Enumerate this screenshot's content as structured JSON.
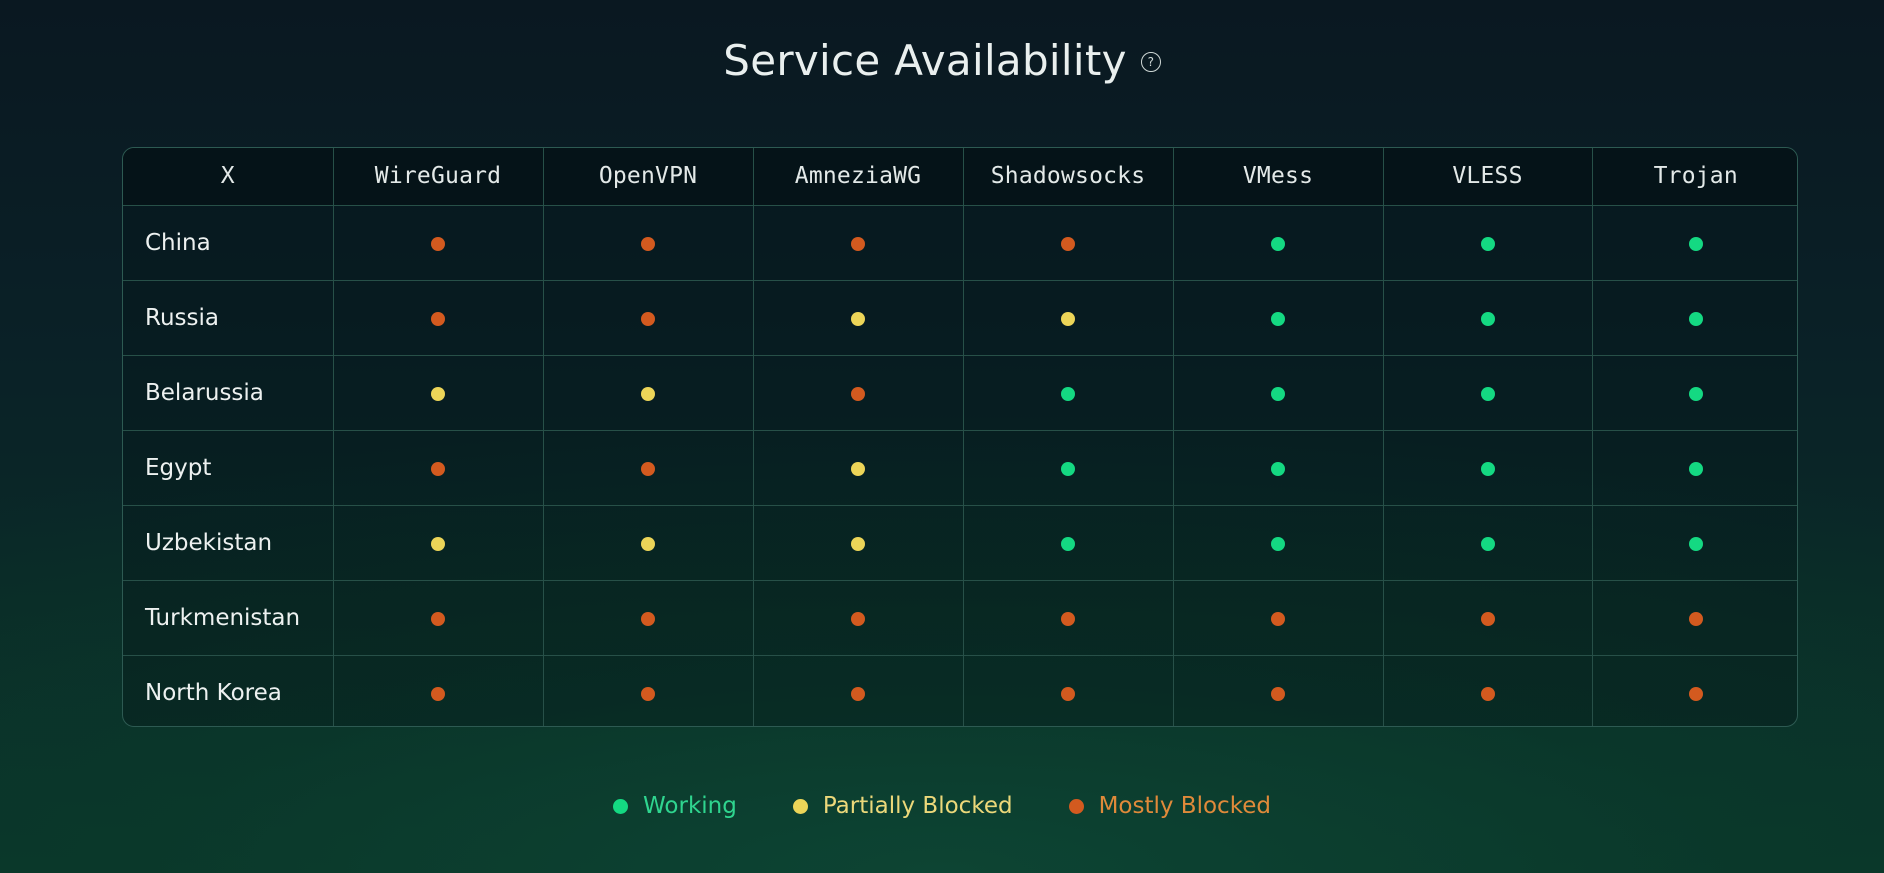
{
  "title": "Service Availability",
  "help_icon": "question-circle-icon",
  "colors": {
    "working": "#14d982",
    "partial": "#ecd558",
    "blocked": "#d35a1f",
    "legend_working_text": "#2fd58f",
    "legend_partial_text": "#ecd87a",
    "legend_blocked_text": "#e08a3a"
  },
  "table": {
    "corner": "X",
    "protocols": [
      "WireGuard",
      "OpenVPN",
      "AmneziaWG",
      "Shadowsocks",
      "VMess",
      "VLESS",
      "Trojan"
    ],
    "rows": [
      {
        "country": "China",
        "status": [
          "blocked",
          "blocked",
          "blocked",
          "blocked",
          "working",
          "working",
          "working"
        ]
      },
      {
        "country": "Russia",
        "status": [
          "blocked",
          "blocked",
          "partial",
          "partial",
          "working",
          "working",
          "working"
        ]
      },
      {
        "country": "Belarussia",
        "status": [
          "partial",
          "partial",
          "blocked",
          "working",
          "working",
          "working",
          "working"
        ]
      },
      {
        "country": "Egypt",
        "status": [
          "blocked",
          "blocked",
          "partial",
          "working",
          "working",
          "working",
          "working"
        ]
      },
      {
        "country": "Uzbekistan",
        "status": [
          "partial",
          "partial",
          "partial",
          "working",
          "working",
          "working",
          "working"
        ]
      },
      {
        "country": "Turkmenistan",
        "status": [
          "blocked",
          "blocked",
          "blocked",
          "blocked",
          "blocked",
          "blocked",
          "blocked"
        ]
      },
      {
        "country": "North Korea",
        "status": [
          "blocked",
          "blocked",
          "blocked",
          "blocked",
          "blocked",
          "blocked",
          "blocked"
        ]
      }
    ]
  },
  "legend": [
    {
      "key": "working",
      "label": "Working"
    },
    {
      "key": "partial",
      "label": "Partially Blocked"
    },
    {
      "key": "blocked",
      "label": "Mostly Blocked"
    }
  ]
}
